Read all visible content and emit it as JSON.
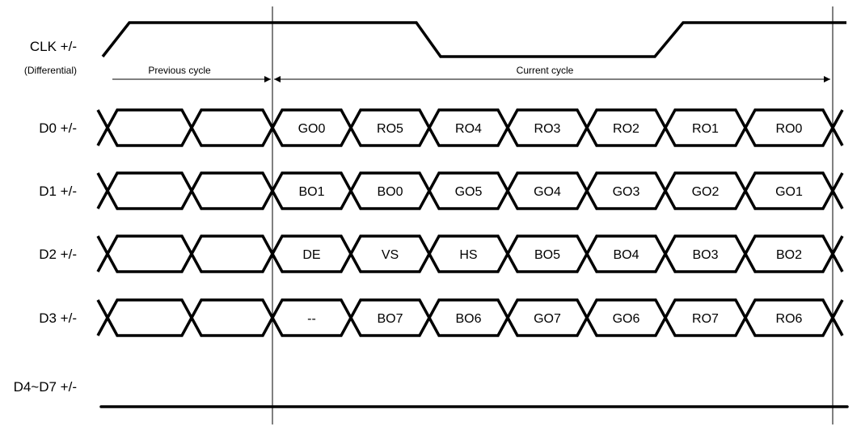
{
  "signals": {
    "clk": {
      "label": "CLK +/-",
      "sublabel": "(Differential)"
    },
    "rows": [
      {
        "label": "D0 +/-",
        "bits": [
          "GO0",
          "RO5",
          "RO4",
          "RO3",
          "RO2",
          "RO1",
          "RO0"
        ]
      },
      {
        "label": "D1 +/-",
        "bits": [
          "BO1",
          "BO0",
          "GO5",
          "GO4",
          "GO3",
          "GO2",
          "GO1"
        ]
      },
      {
        "label": "D2 +/-",
        "bits": [
          "DE",
          "VS",
          "HS",
          "BO5",
          "BO4",
          "BO3",
          "BO2"
        ]
      },
      {
        "label": "D3 +/-",
        "bits": [
          "--",
          "BO7",
          "BO6",
          "GO7",
          "GO6",
          "RO7",
          "RO6"
        ]
      }
    ],
    "static_row": {
      "label": "D4~D7 +/-"
    }
  },
  "annotations": {
    "previous_cycle": "Previous cycle",
    "current_cycle": "Current cycle"
  },
  "colors": {
    "line": "#000000",
    "background": "#ffffff"
  }
}
